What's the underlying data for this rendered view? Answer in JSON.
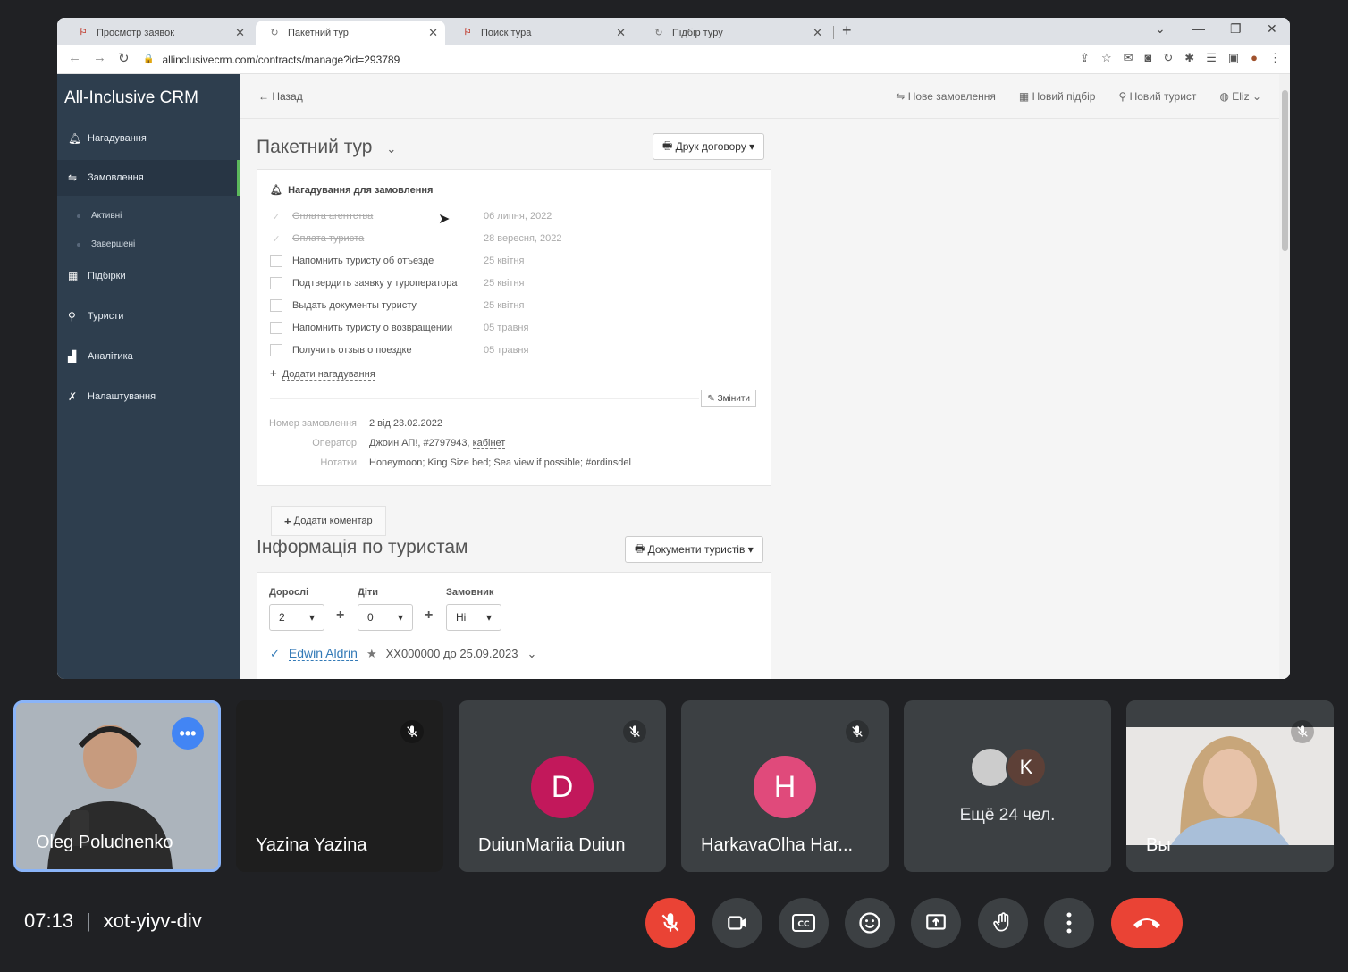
{
  "browser": {
    "tabs": [
      {
        "title": "Просмотр заявок",
        "icon": "crm-icon"
      },
      {
        "title": "Пакетний тур",
        "icon": "loading-icon"
      },
      {
        "title": "Поиск тура",
        "icon": "crm-icon"
      },
      {
        "title": "Підбір туру",
        "icon": "loading-icon"
      }
    ],
    "url": "allinclusivecrm.com/contracts/manage?id=293789"
  },
  "crm": {
    "brand": "All-Inclusive CRM",
    "sidebar": {
      "items": [
        {
          "label": "Нагадування"
        },
        {
          "label": "Замовлення"
        },
        {
          "label": "Підбірки"
        },
        {
          "label": "Туристи"
        },
        {
          "label": "Аналітика"
        },
        {
          "label": "Налаштування"
        }
      ],
      "sub_items": [
        {
          "label": "Активні"
        },
        {
          "label": "Завершені"
        }
      ]
    },
    "topbar": {
      "back": "Назад",
      "new_order": "Нове замовлення",
      "new_selection": "Новий підбір",
      "new_tourist": "Новий турист",
      "user": "Eliz"
    },
    "order": {
      "title": "Пакетний тур",
      "print_button": "Друк договору",
      "reminders_title": "Нагадування для замовлення",
      "reminders": [
        {
          "text": "Оплата агентства",
          "date": "06 липня, 2022",
          "done": true
        },
        {
          "text": "Оплата туриста",
          "date": "28 вересня, 2022",
          "done": true
        },
        {
          "text": "Напомнить туристу об отъезде",
          "date": "25 квітня",
          "done": false
        },
        {
          "text": "Подтвердить заявку у туроператора",
          "date": "25 квітня",
          "done": false
        },
        {
          "text": "Выдать документы туристу",
          "date": "25 квітня",
          "done": false
        },
        {
          "text": "Напомнить туристу о возвращении",
          "date": "05 травня",
          "done": false
        },
        {
          "text": "Получить отзыв о поездке",
          "date": "05 травня",
          "done": false
        }
      ],
      "add_reminder": "Додати нагадування",
      "edit_button": "Змінити",
      "order_number_label": "Номер замовлення",
      "order_number": "2 від 23.02.2022",
      "operator_label": "Оператор",
      "operator": "Джоин АП!, #2797943,",
      "operator_link": "кабінет",
      "notes_label": "Нотатки",
      "notes": "Honeymoon; King Size bed; Sea view if possible; #ordinsdel",
      "add_comment": "Додати коментар"
    },
    "tourists": {
      "title": "Інформація по туристам",
      "docs_button": "Документи туристів",
      "adults_label": "Дорослі",
      "adults": "2",
      "children_label": "Діти",
      "children": "0",
      "customer_label": "Замовник",
      "customer": "Ні",
      "tourist_name": "Edwin Aldrin",
      "passport": "XX000000 до 25.09.2023"
    }
  },
  "meet": {
    "participants": [
      {
        "name": "Oleg Poludnenko"
      },
      {
        "name": "Yazina Yazina"
      },
      {
        "name": "DuiunMariia Duiun",
        "initial": "D",
        "color": "#c2185b"
      },
      {
        "name": "HarkavaOlha Har...",
        "initial": "H",
        "color": "#d81b60"
      },
      {
        "others": "Ещё 24 чел.",
        "initial": "K"
      },
      {
        "name": "Вы"
      }
    ],
    "time": "07:13",
    "code": "xot-yiyv-div"
  }
}
